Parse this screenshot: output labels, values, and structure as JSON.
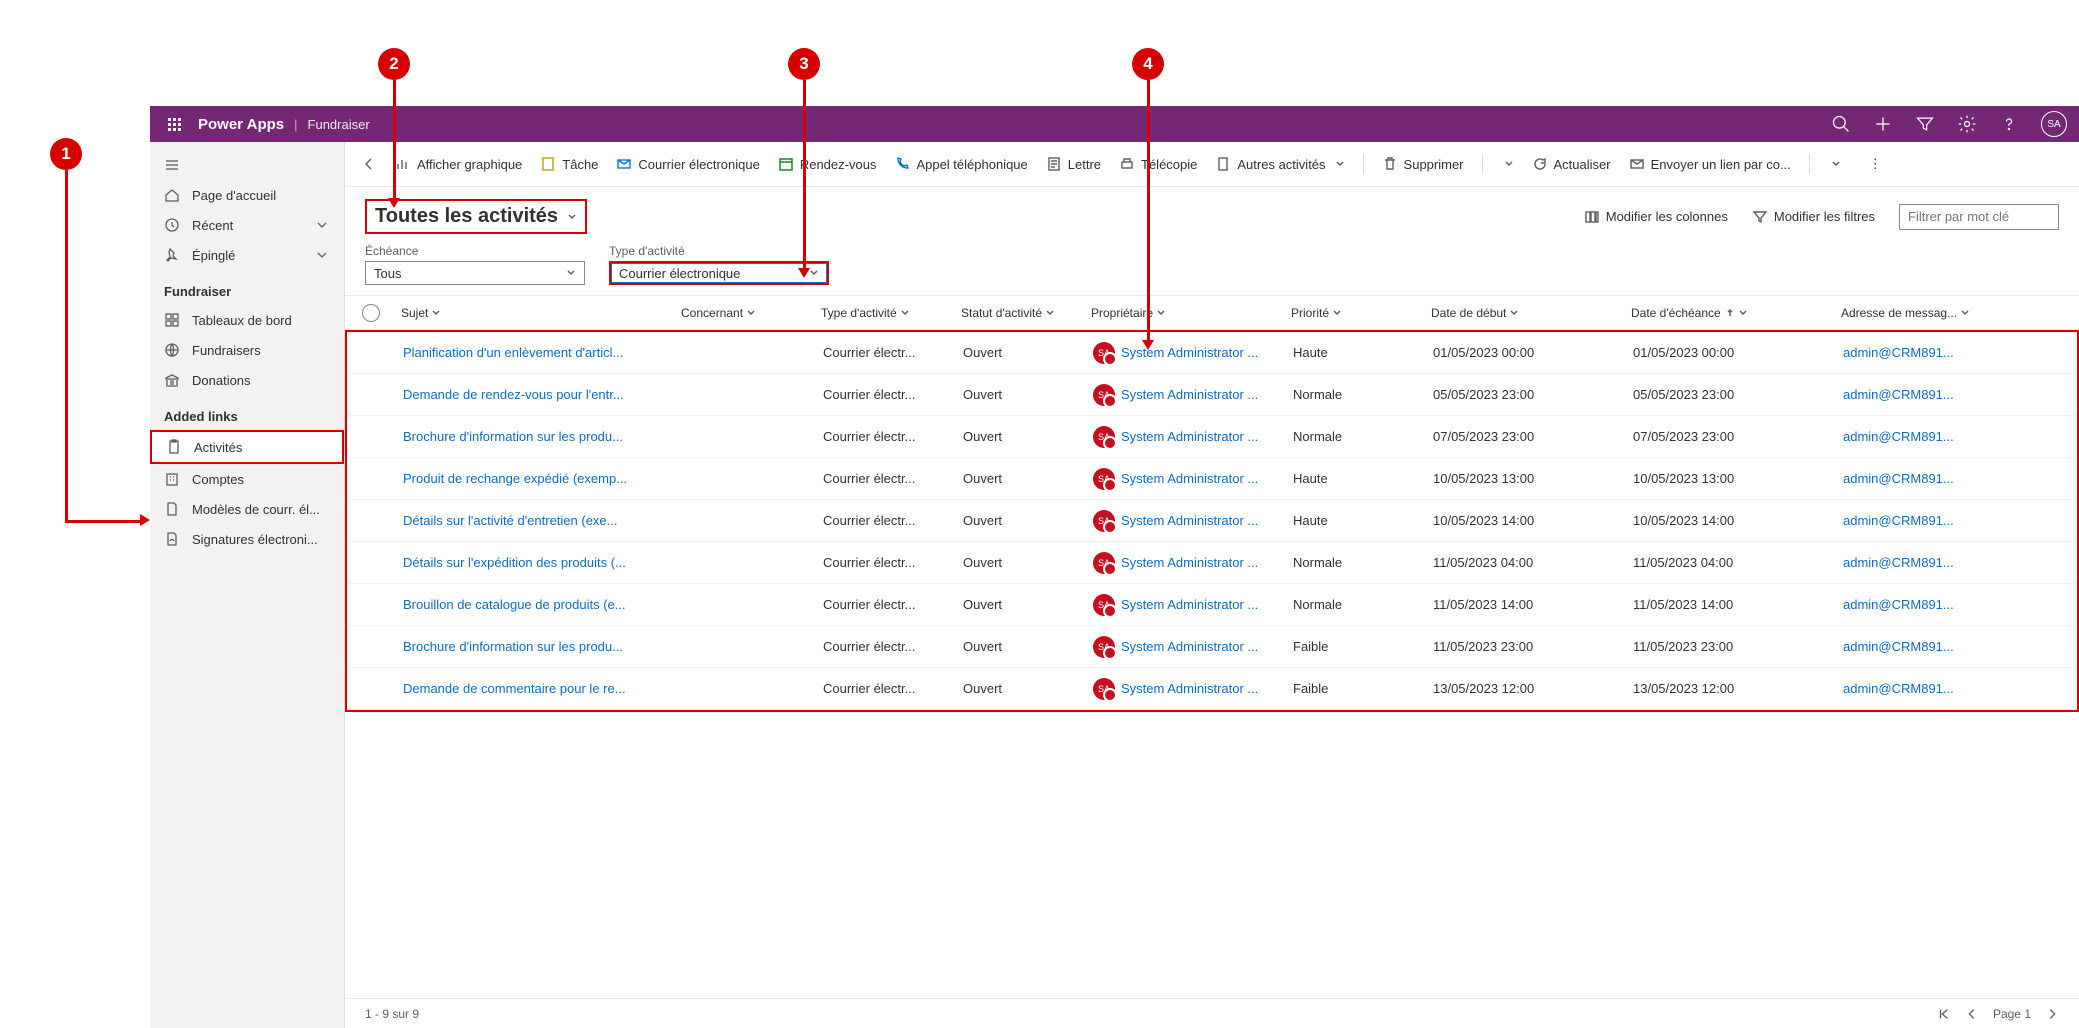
{
  "top": {
    "product": "Power Apps",
    "app": "Fundraiser",
    "avatar": "SA"
  },
  "nav": {
    "hamburger": "≡",
    "home": "Page d'accueil",
    "recent": "Récent",
    "pinned": "Épinglé",
    "section_app": "Fundraiser",
    "dashboards": "Tableaux de bord",
    "fundraisers": "Fundraisers",
    "donations": "Donations",
    "section_links": "Added links",
    "activities": "Activités",
    "accounts": "Comptes",
    "email_templates": "Modèles de courr. él...",
    "signatures": "Signatures électroni..."
  },
  "cmd": {
    "back": "←",
    "chart": "Afficher graphique",
    "task": "Tâche",
    "email": "Courrier électronique",
    "appt": "Rendez-vous",
    "phone": "Appel téléphonique",
    "letter": "Lettre",
    "fax": "Télécopie",
    "other": "Autres activités",
    "delete": "Supprimer",
    "refresh": "Actualiser",
    "sendlink": "Envoyer un lien par co..."
  },
  "view": {
    "title": "Toutes les activités",
    "edit_cols": "Modifier les colonnes",
    "edit_filters": "Modifier les filtres",
    "filter_placeholder": "Filtrer par mot clé"
  },
  "filters": {
    "due_label": "Échéance",
    "due_value": "Tous",
    "type_label": "Type d'activité",
    "type_value": "Courrier électronique"
  },
  "columns": {
    "subject": "Sujet",
    "regarding": "Concernant",
    "type": "Type d'activité",
    "status": "Statut d'activité",
    "owner": "Propriétaire",
    "priority": "Priorité",
    "start": "Date de début",
    "due": "Date d'échéance",
    "email": "Adresse de messag..."
  },
  "rows": [
    {
      "subject": "Planification d'un enlèvement d'articl...",
      "type": "Courrier électr...",
      "status": "Ouvert",
      "owner": "System Administrator ...",
      "priority": "Haute",
      "start": "01/05/2023 00:00",
      "due": "01/05/2023 00:00",
      "email": "admin@CRM891..."
    },
    {
      "subject": "Demande de rendez-vous pour l'entr...",
      "type": "Courrier électr...",
      "status": "Ouvert",
      "owner": "System Administrator ...",
      "priority": "Normale",
      "start": "05/05/2023 23:00",
      "due": "05/05/2023 23:00",
      "email": "admin@CRM891..."
    },
    {
      "subject": "Brochure d'information sur les produ...",
      "type": "Courrier électr...",
      "status": "Ouvert",
      "owner": "System Administrator ...",
      "priority": "Normale",
      "start": "07/05/2023 23:00",
      "due": "07/05/2023 23:00",
      "email": "admin@CRM891..."
    },
    {
      "subject": "Produit de rechange expédié (exemp...",
      "type": "Courrier électr...",
      "status": "Ouvert",
      "owner": "System Administrator ...",
      "priority": "Haute",
      "start": "10/05/2023 13:00",
      "due": "10/05/2023 13:00",
      "email": "admin@CRM891..."
    },
    {
      "subject": "Détails sur l'activité d'entretien (exe...",
      "type": "Courrier électr...",
      "status": "Ouvert",
      "owner": "System Administrator ...",
      "priority": "Haute",
      "start": "10/05/2023 14:00",
      "due": "10/05/2023 14:00",
      "email": "admin@CRM891..."
    },
    {
      "subject": "Détails sur l'expédition des produits (...",
      "type": "Courrier électr...",
      "status": "Ouvert",
      "owner": "System Administrator ...",
      "priority": "Normale",
      "start": "11/05/2023 04:00",
      "due": "11/05/2023 04:00",
      "email": "admin@CRM891..."
    },
    {
      "subject": "Brouillon de catalogue de produits (e...",
      "type": "Courrier électr...",
      "status": "Ouvert",
      "owner": "System Administrator ...",
      "priority": "Normale",
      "start": "11/05/2023 14:00",
      "due": "11/05/2023 14:00",
      "email": "admin@CRM891..."
    },
    {
      "subject": "Brochure d'information sur les produ...",
      "type": "Courrier électr...",
      "status": "Ouvert",
      "owner": "System Administrator ...",
      "priority": "Faible",
      "start": "11/05/2023 23:00",
      "due": "11/05/2023 23:00",
      "email": "admin@CRM891..."
    },
    {
      "subject": "Demande de commentaire pour le re...",
      "type": "Courrier électr...",
      "status": "Ouvert",
      "owner": "System Administrator ...",
      "priority": "Faible",
      "start": "13/05/2023 12:00",
      "due": "13/05/2023 12:00",
      "email": "admin@CRM891..."
    }
  ],
  "footer": {
    "count": "1 - 9 sur 9",
    "page": "Page 1"
  },
  "markers": {
    "m1": "1",
    "m2": "2",
    "m3": "3",
    "m4": "4"
  },
  "owner_initials": "SA"
}
